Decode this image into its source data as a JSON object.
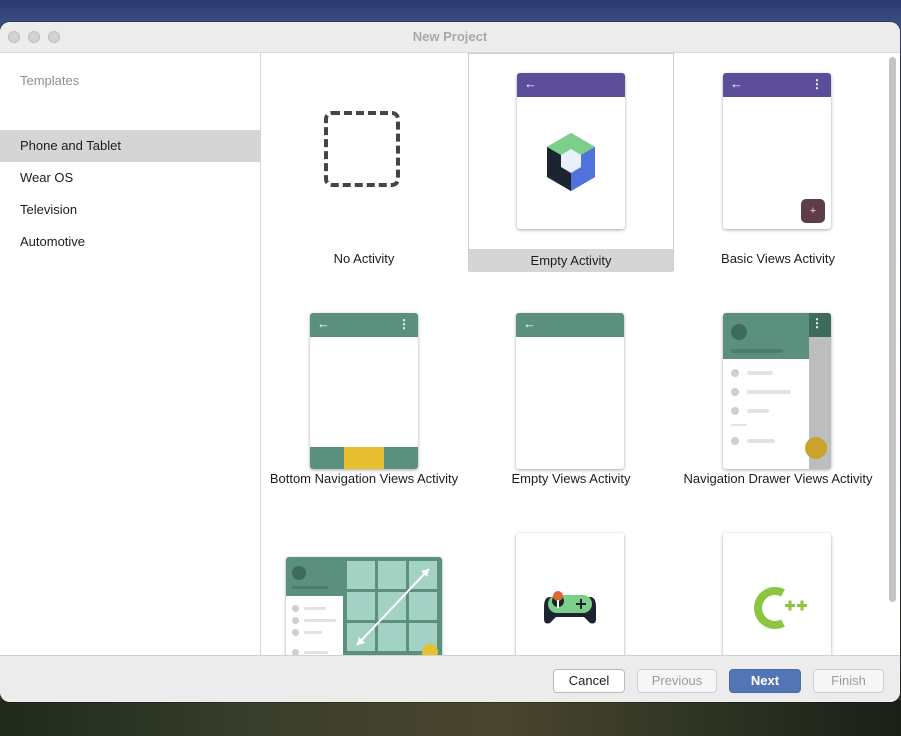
{
  "window": {
    "title": "New Project"
  },
  "sidebar": {
    "header": "Templates",
    "items": [
      {
        "label": "Phone and Tablet",
        "selected": true
      },
      {
        "label": "Wear OS"
      },
      {
        "label": "Television"
      },
      {
        "label": "Automotive"
      }
    ]
  },
  "templates": [
    {
      "label": "No Activity"
    },
    {
      "label": "Empty Activity",
      "selected": true
    },
    {
      "label": "Basic Views Activity"
    },
    {
      "label": "Bottom Navigation Views Activity"
    },
    {
      "label": "Empty Views Activity"
    },
    {
      "label": "Navigation Drawer Views Activity"
    }
  ],
  "footer": {
    "cancel": "Cancel",
    "previous": "Previous",
    "next": "Next",
    "finish": "Finish"
  },
  "colors": {
    "purple_appbar": "#5c4d9a",
    "teal_appbar": "#5b8f7e",
    "fab": "#5e3c4a",
    "yellow": "#e6bf31",
    "primary_button": "#5475b5"
  }
}
